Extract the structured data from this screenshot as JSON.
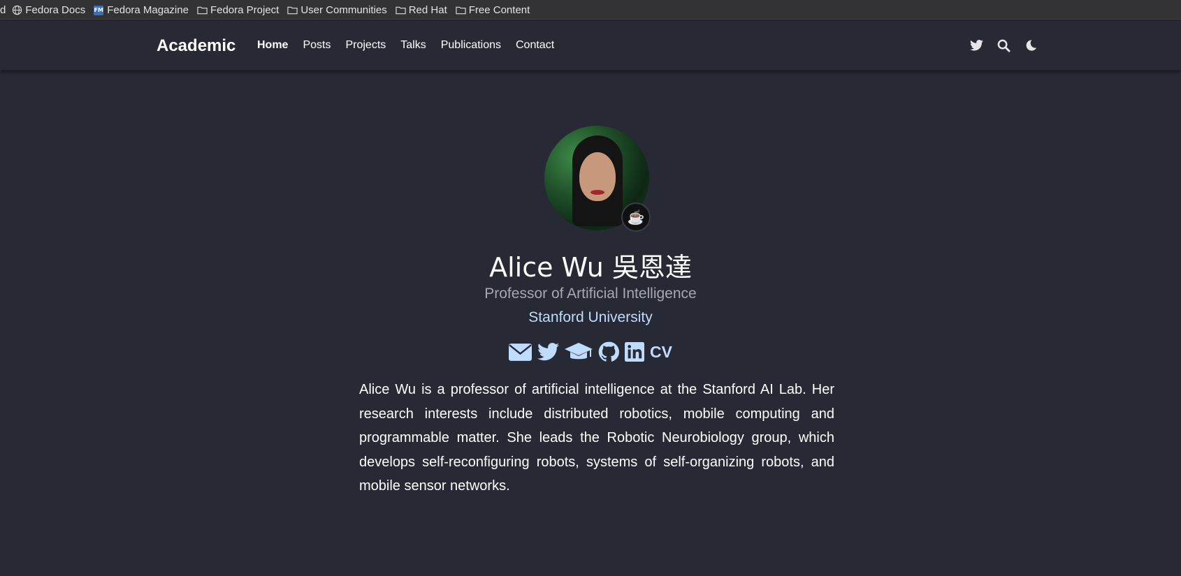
{
  "bookmarks": [
    {
      "label": "d",
      "icon": null
    },
    {
      "label": "Fedora Docs",
      "icon": "globe-icon"
    },
    {
      "label": "Fedora Magazine",
      "icon": "fm-icon"
    },
    {
      "label": "Fedora Project",
      "icon": "folder-icon"
    },
    {
      "label": "User Communities",
      "icon": "folder-icon"
    },
    {
      "label": "Red Hat",
      "icon": "folder-icon"
    },
    {
      "label": "Free Content",
      "icon": "folder-icon"
    }
  ],
  "fm_badge": "FM",
  "navbar": {
    "brand": "Academic",
    "links": [
      "Home",
      "Posts",
      "Projects",
      "Talks",
      "Publications",
      "Contact"
    ],
    "active": "Home",
    "icons": [
      "twitter-icon",
      "search-icon",
      "moon-icon"
    ]
  },
  "profile": {
    "name": "Alice Wu 吳恩達",
    "role": "Professor of Artificial Intelligence",
    "organization": "Stanford University",
    "badge_emoji": "☕",
    "social_icons": [
      "envelope-icon",
      "twitter-icon",
      "graduation-cap-icon",
      "github-icon",
      "linkedin-icon",
      "cv-icon"
    ],
    "cv_label": "CV",
    "bio": "Alice Wu is a professor of artificial intelligence at the Stanford AI Lab. Her research interests include distributed robotics, mobile computing and programmable matter. She leads the Robotic Neurobiology group, which develops self-reconfiguring robots, systems of self-organizing robots, and mobile sensor networks."
  },
  "colors": {
    "background": "#272a35",
    "accent": "#bfdbfe",
    "muted": "#a5a8b3"
  }
}
